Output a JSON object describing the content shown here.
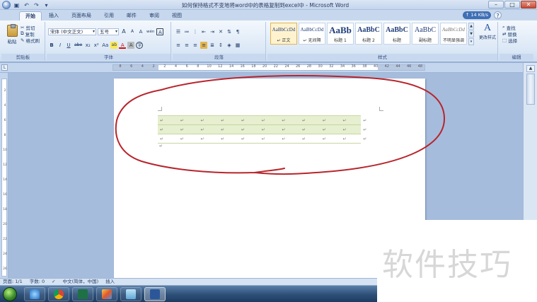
{
  "window": {
    "title": "如何保持格式不变地将word中的表格复制到excel中 - Microsoft Word",
    "minimize_label": "–",
    "maximize_label": "□",
    "close_label": "✕"
  },
  "quick_access": {
    "icons": [
      "save-icon",
      "undo-icon",
      "redo-icon"
    ],
    "undo_label": "↶",
    "redo_label": "↷",
    "dropdown_label": "▾"
  },
  "tabs": [
    {
      "label": "开始",
      "active": true
    },
    {
      "label": "插入",
      "active": false
    },
    {
      "label": "页面布局",
      "active": false
    },
    {
      "label": "引用",
      "active": false
    },
    {
      "label": "邮件",
      "active": false
    },
    {
      "label": "审阅",
      "active": false
    },
    {
      "label": "视图",
      "active": false
    }
  ],
  "help": {
    "net_speed": "↑ 14 KB/s",
    "help_label": "?"
  },
  "ribbon": {
    "clipboard": {
      "group_label": "剪贴板",
      "paste": "粘贴",
      "cut": "剪切",
      "copy": "复制",
      "format_painter": "格式刷"
    },
    "font": {
      "group_label": "字体",
      "font_name": "宋体 (中文正文)",
      "font_size": "五号",
      "bold": "B",
      "italic": "I",
      "underline": "U",
      "strike": "abe",
      "subscript": "x₂",
      "superscript": "x²",
      "change_case": "Aa",
      "grow": "A",
      "shrink": "A",
      "clear": "A",
      "phonetic": "wén",
      "border_char": "A",
      "highlight": "ab",
      "font_color": "A",
      "char_shade": "A",
      "enclose": "字"
    },
    "paragraph": {
      "group_label": "段落"
    },
    "styles": {
      "group_label": "样式",
      "items": [
        {
          "preview": "AaBbCcDd",
          "name": "↵ 正文",
          "selected": true
        },
        {
          "preview": "AaBbCcDd",
          "name": "↵ 无间隔",
          "selected": false
        },
        {
          "preview": "AaBb",
          "name": "标题 1",
          "selected": false
        },
        {
          "preview": "AaBbC",
          "name": "标题 2",
          "selected": false
        },
        {
          "preview": "AaBbC",
          "name": "标题",
          "selected": false
        },
        {
          "preview": "AaBbC",
          "name": "副标题",
          "selected": false
        },
        {
          "preview": "AaBbCcDd",
          "name": "不明显强调",
          "selected": false
        }
      ],
      "change_styles": "更改样式"
    },
    "editing": {
      "group_label": "编辑",
      "find": "查找",
      "replace": "替换",
      "select": "选择"
    }
  },
  "ruler": {
    "ticks": [
      "8",
      "6",
      "4",
      "2",
      "2",
      "4",
      "6",
      "8",
      "10",
      "12",
      "14",
      "16",
      "18",
      "20",
      "22",
      "24",
      "26",
      "28",
      "30",
      "32",
      "34",
      "36",
      "38",
      "40",
      "42",
      "44",
      "46",
      "48"
    ],
    "vertical_ticks": [
      "2",
      "4",
      "6",
      "8",
      "10",
      "12",
      "14",
      "16",
      "18",
      "20",
      "22",
      "24",
      "26"
    ]
  },
  "document": {
    "paragraph_mark": "↵",
    "cell_mark": "↵",
    "table": {
      "rows": 3,
      "cols": 10,
      "shaded_rows": [
        0,
        1
      ]
    }
  },
  "statusbar": {
    "page": "页面: 1/1",
    "words": "字数: 0",
    "language": "中文(简体，中国)",
    "mode": "插入"
  },
  "taskbar": {
    "apps": [
      "ie-icon",
      "chrome-icon",
      "excel-icon",
      "paint-icon",
      "folder-icon",
      "word-icon"
    ]
  },
  "watermark": {
    "text": "软件技巧"
  },
  "colors": {
    "annotation": "#b8252c",
    "table_shade": "#e6efcf",
    "table_rule": "#c8d6a0"
  }
}
